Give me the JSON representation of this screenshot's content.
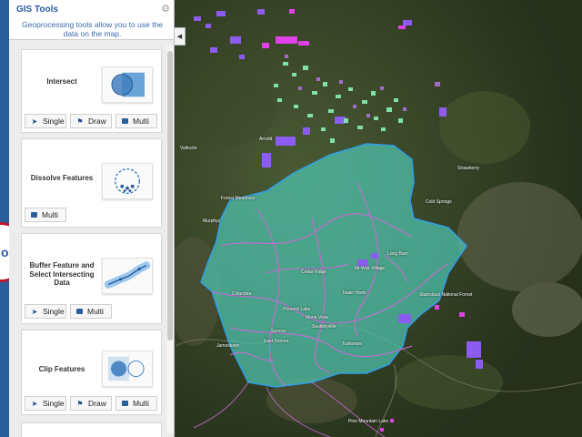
{
  "panel": {
    "title": "GIS Tools",
    "subtitle": "Geoprocessing tools allow you to use the data on the map.",
    "collapse_icon": "chevron-left-icon",
    "settings_icon": "gear-icon"
  },
  "side_tab": {
    "label": "ols"
  },
  "tools": [
    {
      "name": "Intersect",
      "buttons": [
        "Single",
        "Draw",
        "Multi"
      ]
    },
    {
      "name": "Dissolve Features",
      "buttons": [
        "Multi"
      ]
    },
    {
      "name": "Buffer Feature and Select Intersecting Data",
      "buttons": [
        "Single",
        "Multi"
      ]
    },
    {
      "name": "Clip Features",
      "buttons": [
        "Single",
        "Draw",
        "Multi"
      ]
    }
  ],
  "map": {
    "labels": [
      "Arnold",
      "Strawberry",
      "Cold Springs",
      "Pine Mountain Lake",
      "Cedar Ridge",
      "Twain Harte",
      "Mono Vista",
      "Phoenix Lake",
      "Sonora",
      "East Sonora",
      "Soulsbyville",
      "Tuolumne",
      "Columbia",
      "Jamestown",
      "Stanislaus National Forest",
      "Long Barn",
      "Mi-Wuk Village",
      "Forest Meadows",
      "Murphys",
      "Vallecito"
    ],
    "colors": {
      "polygon_fill": "#4fc7b2",
      "polygon_stroke": "#2f9fe8",
      "roads": "#c86ad6",
      "parcels_purple": "#8c5cf0",
      "parcels_green": "#7fe0a8",
      "parcels_magenta": "#e040e8",
      "terrain": "#3a4a2a"
    }
  }
}
